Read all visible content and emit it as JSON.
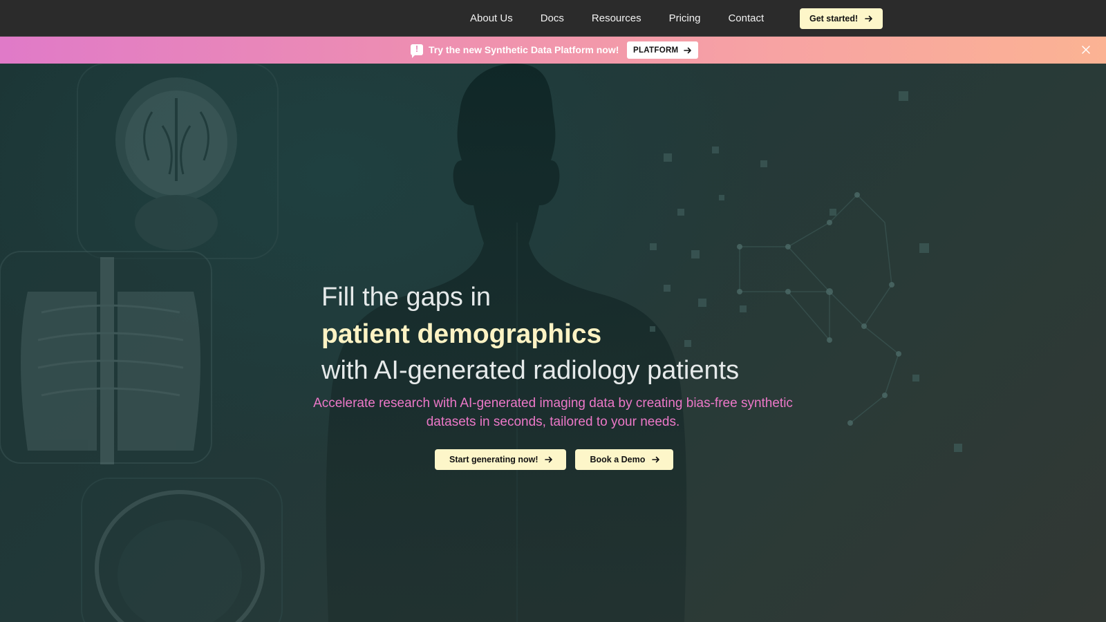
{
  "nav": {
    "links": [
      "About Us",
      "Docs",
      "Resources",
      "Pricing",
      "Contact"
    ],
    "cta_label": "Get started!"
  },
  "banner": {
    "icon": "announcement-icon",
    "text": "Try the new Synthetic Data Platform now!",
    "button_label": "PLATFORM",
    "close_icon": "close-icon"
  },
  "hero": {
    "headline_line1": "Fill the gaps in",
    "headline_line2": "patient demographics",
    "headline_line3": "with AI-generated radiology patients",
    "subheadline": "Accelerate research with AI-generated imaging data by creating bias-free synthetic datasets in seconds, tailored to your needs.",
    "primary_button": "Start generating now!",
    "secondary_button": "Book a Demo"
  },
  "colors": {
    "nav_bg": "#2b2b2b",
    "button_bg": "#fdf6c9",
    "highlight_text": "#fdf3c4",
    "subheadline_text": "#ec78c8",
    "banner_gradient_start": "#e07ac8",
    "banner_gradient_end": "#fbb393"
  }
}
